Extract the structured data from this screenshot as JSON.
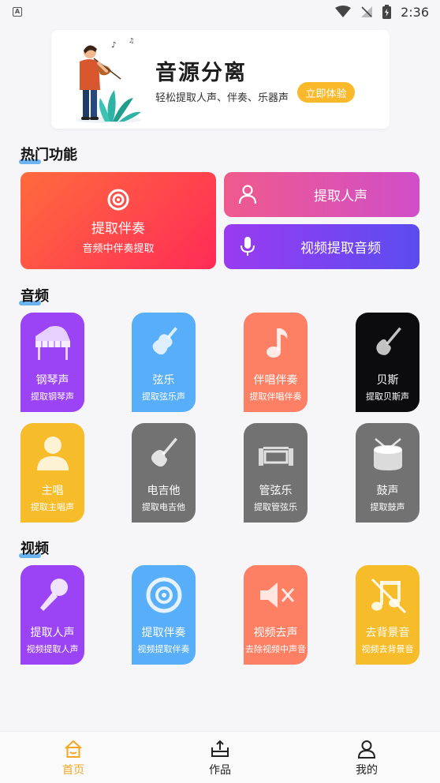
{
  "status_bar": {
    "time": "2:36",
    "left_badge": "A"
  },
  "banner": {
    "title": "音源分离",
    "subtitle": "轻松提取人声、伴奏、乐器声",
    "button": "立即体验"
  },
  "hot": {
    "title": "热门功能",
    "big": {
      "title": "提取伴奏",
      "subtitle": "音频中伴奏提取"
    },
    "top": {
      "title": "提取人声"
    },
    "bottom": {
      "title": "视频提取音频"
    }
  },
  "audio": {
    "title": "音频",
    "tiles": [
      {
        "name": "钢琴声",
        "sub": "提取钢琴声",
        "color": "#9b44f5",
        "icon": "piano-icon"
      },
      {
        "name": "弦乐",
        "sub": "提取弦乐声",
        "color": "#58aef8",
        "icon": "violin-icon"
      },
      {
        "name": "伴唱伴奏",
        "sub": "提取伴唱伴奏",
        "color": "#fe8064",
        "icon": "music-note-icon"
      },
      {
        "name": "贝斯",
        "sub": "提取贝斯声",
        "color": "#0c0c0e",
        "icon": "bass-guitar-icon"
      },
      {
        "name": "主唱",
        "sub": "提取主唱声",
        "color": "#f7bc2a",
        "icon": "singer-icon"
      },
      {
        "name": "电吉他",
        "sub": "提取电吉他",
        "color": "#727272",
        "icon": "electric-guitar-icon"
      },
      {
        "name": "管弦乐",
        "sub": "提取管弦乐",
        "color": "#727272",
        "icon": "orchestra-icon"
      },
      {
        "name": "鼓声",
        "sub": "提取鼓声",
        "color": "#727272",
        "icon": "drum-icon"
      }
    ]
  },
  "video": {
    "title": "视频",
    "tiles": [
      {
        "name": "提取人声",
        "sub": "视频提取人声",
        "color": "#9b44f5",
        "icon": "microphone-icon"
      },
      {
        "name": "提取伴奏",
        "sub": "视频提取伴奏",
        "color": "#58aef8",
        "icon": "disc-icon"
      },
      {
        "name": "视频去声",
        "sub": "去除视频中声音",
        "color": "#fe8064",
        "icon": "mute-icon"
      },
      {
        "name": "去背景音",
        "sub": "视频去背景音",
        "color": "#f7bc2a",
        "icon": "no-music-icon"
      }
    ]
  },
  "tabbar": {
    "items": [
      {
        "label": "首页",
        "icon": "home-icon",
        "active": true
      },
      {
        "label": "作品",
        "icon": "works-icon",
        "active": false
      },
      {
        "label": "我的",
        "icon": "profile-icon",
        "active": false
      }
    ],
    "active_color": "#f5a623"
  }
}
